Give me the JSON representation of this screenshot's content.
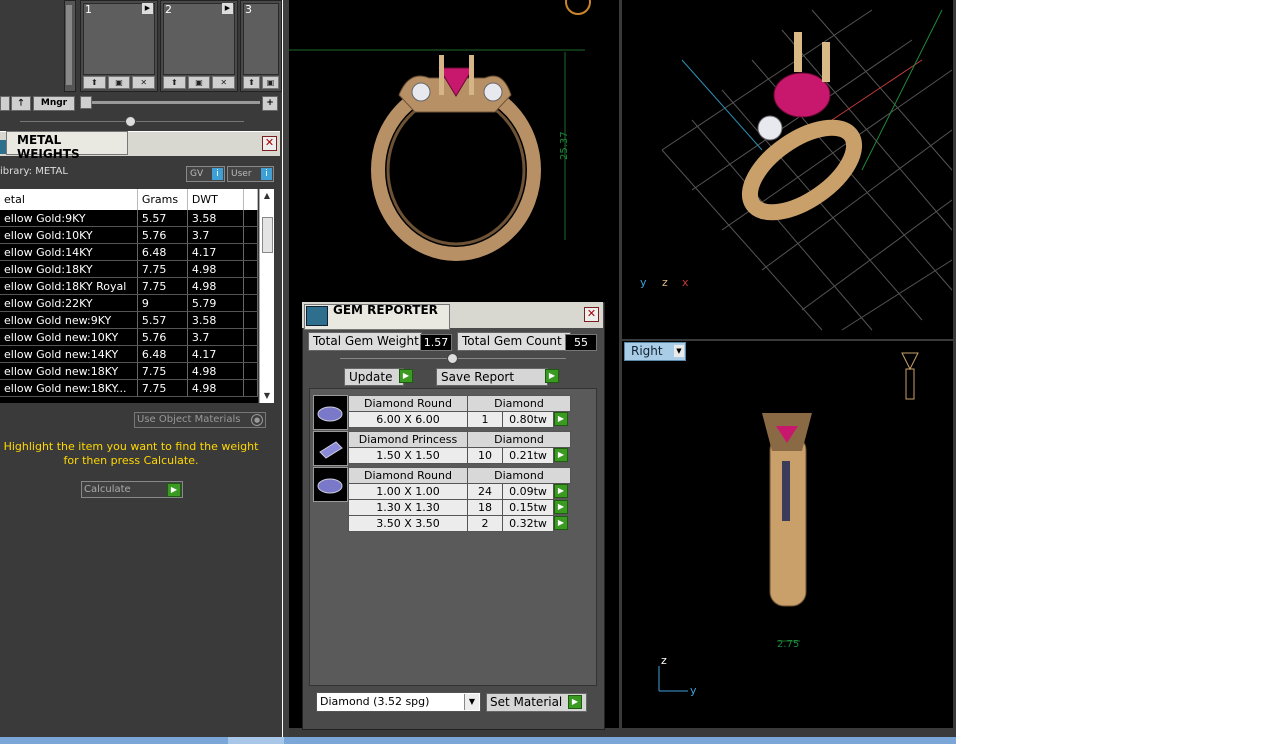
{
  "slots": [
    {
      "num": "1"
    },
    {
      "num": "2"
    },
    {
      "num": "3"
    }
  ],
  "toolbar": {
    "mngr_label": "Mngr",
    "plus_label": "+"
  },
  "metal_weights": {
    "title": "METAL WEIGHTS",
    "library_label": "ibrary: METAL",
    "gv_label": "GV",
    "user_label": "User",
    "columns": [
      "etal",
      "Grams",
      "DWT"
    ],
    "rows": [
      [
        "ellow Gold:9KY",
        "5.57",
        "3.58"
      ],
      [
        "ellow Gold:10KY",
        "5.76",
        "3.7"
      ],
      [
        "ellow Gold:14KY",
        "6.48",
        "4.17"
      ],
      [
        "ellow Gold:18KY",
        "7.75",
        "4.98"
      ],
      [
        "ellow Gold:18KY Royal",
        "7.75",
        "4.98"
      ],
      [
        "ellow Gold:22KY",
        "9",
        "5.79"
      ],
      [
        "ellow Gold new:9KY",
        "5.57",
        "3.58"
      ],
      [
        "ellow Gold new:10KY",
        "5.76",
        "3.7"
      ],
      [
        "ellow Gold new:14KY",
        "6.48",
        "4.17"
      ],
      [
        "ellow Gold new:18KY",
        "7.75",
        "4.98"
      ],
      [
        "ellow Gold new:18KY...",
        "7.75",
        "4.98"
      ]
    ],
    "use_object_materials": "Use Object Materials",
    "hint_line1": "Highlight the item you want to find the weight",
    "hint_line2": "for then press Calculate.",
    "calculate_label": "Calculate"
  },
  "front_view": {
    "dimension_label": "25.37"
  },
  "right_view": {
    "view_name": "Right",
    "dimension_label": "2.75",
    "axis_z": "z",
    "axis_y": "y"
  },
  "persp_view": {
    "axis_y": "y",
    "axis_z": "z",
    "axis_x": "x"
  },
  "gem_reporter": {
    "title": "GEM REPORTER",
    "total_weight_label": "Total Gem Weight",
    "total_weight_value": "1.57",
    "total_count_label": "Total Gem Count",
    "total_count_value": "55",
    "update_label": "Update",
    "save_report_label": "Save Report",
    "groups": [
      {
        "shape": "Diamond Round",
        "material": "Diamond",
        "rows": [
          {
            "size": "6.00 X 6.00",
            "qty": "1",
            "tw": "0.80tw"
          }
        ]
      },
      {
        "shape": "Diamond Princess",
        "material": "Diamond",
        "rows": [
          {
            "size": "1.50 X 1.50",
            "qty": "10",
            "tw": "0.21tw"
          }
        ]
      },
      {
        "shape": "Diamond Round",
        "material": "Diamond",
        "rows": [
          {
            "size": "1.00 X 1.00",
            "qty": "24",
            "tw": "0.09tw"
          },
          {
            "size": "1.30 X 1.30",
            "qty": "18",
            "tw": "0.15tw"
          },
          {
            "size": "3.50 X 3.50",
            "qty": "2",
            "tw": "0.32tw"
          }
        ]
      }
    ],
    "material_select": "Diamond    (3.52 spg)",
    "set_material_label": "Set Material"
  },
  "colors": {
    "accent_green": "#3a9a22",
    "hint_yellow": "#ffd800",
    "panel_dark": "#3a3a3a",
    "gold": "#c9a06a",
    "ruby": "#c8186e"
  }
}
